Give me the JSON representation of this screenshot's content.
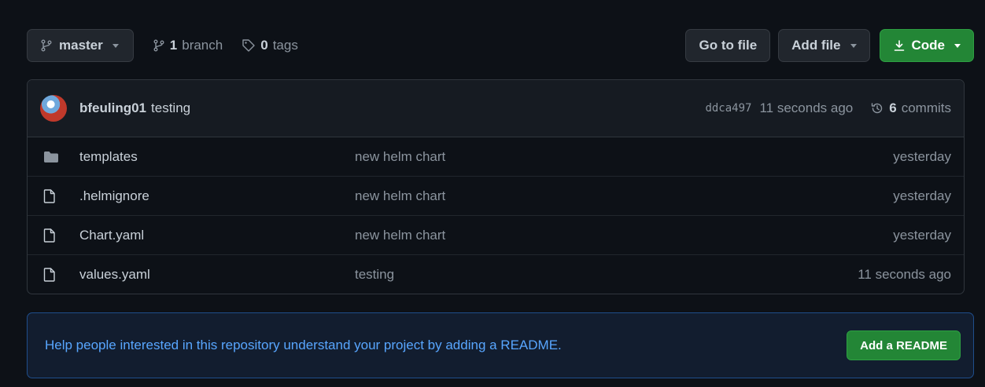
{
  "toolbar": {
    "branch_label": "master",
    "branch_count": "1",
    "branch_word": "branch",
    "tag_count": "0",
    "tag_word": "tags",
    "goto_file_label": "Go to file",
    "add_file_label": "Add file",
    "code_label": "Code"
  },
  "latest_commit": {
    "author": "bfeuling01",
    "message": "testing",
    "sha": "ddca497",
    "time": "11 seconds ago",
    "commit_count": "6",
    "commit_word": "commits"
  },
  "files": [
    {
      "type": "folder",
      "name": "templates",
      "message": "new helm chart",
      "age": "yesterday"
    },
    {
      "type": "file",
      "name": ".helmignore",
      "message": "new helm chart",
      "age": "yesterday"
    },
    {
      "type": "file",
      "name": "Chart.yaml",
      "message": "new helm chart",
      "age": "yesterday"
    },
    {
      "type": "file",
      "name": "values.yaml",
      "message": "testing",
      "age": "11 seconds ago"
    }
  ],
  "readme_banner": {
    "text": "Help people interested in this repository understand your project by adding a README.",
    "button_label": "Add a README"
  },
  "colors": {
    "background": "#0d1117",
    "accent_green": "#238636",
    "link_blue": "#58a6ff"
  }
}
